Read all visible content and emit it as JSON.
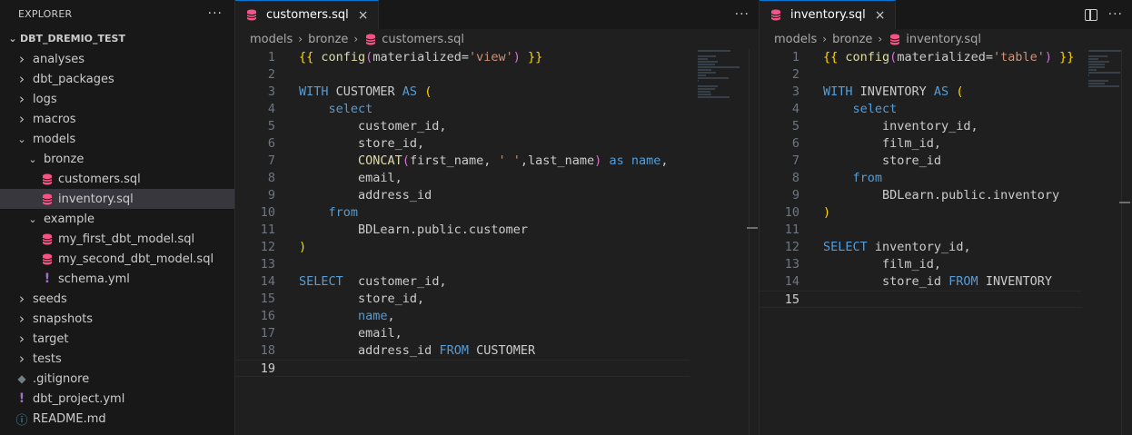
{
  "explorer": {
    "title": "EXPLORER",
    "more_label": "···",
    "root_label": "DBT_DREMIO_TEST",
    "items": [
      {
        "label": "analyses",
        "kind": "folder",
        "depth": 0,
        "expanded": false
      },
      {
        "label": "dbt_packages",
        "kind": "folder",
        "depth": 0,
        "expanded": false
      },
      {
        "label": "logs",
        "kind": "folder",
        "depth": 0,
        "expanded": false
      },
      {
        "label": "macros",
        "kind": "folder",
        "depth": 0,
        "expanded": false
      },
      {
        "label": "models",
        "kind": "folder",
        "depth": 0,
        "expanded": true
      },
      {
        "label": "bronze",
        "kind": "folder",
        "depth": 1,
        "expanded": true
      },
      {
        "label": "customers.sql",
        "kind": "sql",
        "depth": 2
      },
      {
        "label": "inventory.sql",
        "kind": "sql",
        "depth": 2,
        "selected": true
      },
      {
        "label": "example",
        "kind": "folder",
        "depth": 1,
        "expanded": true
      },
      {
        "label": "my_first_dbt_model.sql",
        "kind": "sql",
        "depth": 2
      },
      {
        "label": "my_second_dbt_model.sql",
        "kind": "sql",
        "depth": 2
      },
      {
        "label": "schema.yml",
        "kind": "yml",
        "depth": 2
      },
      {
        "label": "seeds",
        "kind": "folder",
        "depth": 0,
        "expanded": false
      },
      {
        "label": "snapshots",
        "kind": "folder",
        "depth": 0,
        "expanded": false
      },
      {
        "label": "target",
        "kind": "folder",
        "depth": 0,
        "expanded": false
      },
      {
        "label": "tests",
        "kind": "folder",
        "depth": 0,
        "expanded": false
      },
      {
        "label": ".gitignore",
        "kind": "git",
        "depth": 0
      },
      {
        "label": "dbt_project.yml",
        "kind": "yml",
        "depth": 0
      },
      {
        "label": "README.md",
        "kind": "info",
        "depth": 0
      }
    ]
  },
  "left_editor": {
    "tab_label": "customers.sql",
    "tab_close": "×",
    "more_label": "···",
    "breadcrumb": [
      "models",
      "bronze",
      "customers.sql"
    ],
    "current_line": 19,
    "lines": [
      [
        [
          "{{ ",
          "brace"
        ],
        [
          "config",
          "fn"
        ],
        [
          "(",
          "paren2"
        ],
        [
          "materialized=",
          "plain"
        ],
        [
          "'view'",
          "str"
        ],
        [
          ")",
          "paren2"
        ],
        [
          " }}",
          "brace"
        ]
      ],
      [],
      [
        [
          "WITH",
          "kw"
        ],
        [
          " CUSTOMER ",
          "plain"
        ],
        [
          "AS",
          "kw"
        ],
        [
          " (",
          "brace"
        ]
      ],
      [
        [
          "    select",
          "kw"
        ]
      ],
      [
        [
          "        customer_id,",
          "plain"
        ]
      ],
      [
        [
          "        store_id,",
          "plain"
        ]
      ],
      [
        [
          "        ",
          "plain"
        ],
        [
          "CONCAT",
          "fn"
        ],
        [
          "(",
          "paren2"
        ],
        [
          "first_name, ",
          "plain"
        ],
        [
          "' '",
          "str"
        ],
        [
          ",last_name",
          "plain"
        ],
        [
          ")",
          "paren2"
        ],
        [
          " as ",
          "kw"
        ],
        [
          "name",
          "kw"
        ],
        [
          ",",
          "plain"
        ]
      ],
      [
        [
          "        email,",
          "plain"
        ]
      ],
      [
        [
          "        address_id",
          "plain"
        ]
      ],
      [
        [
          "    from",
          "kw"
        ]
      ],
      [
        [
          "        BDLearn.public.customer",
          "plain"
        ]
      ],
      [
        [
          ")",
          "brace"
        ]
      ],
      [],
      [
        [
          "SELECT",
          "kw"
        ],
        [
          "  customer_id,",
          "plain"
        ]
      ],
      [
        [
          "        store_id,",
          "plain"
        ]
      ],
      [
        [
          "        ",
          "plain"
        ],
        [
          "name",
          "kw"
        ],
        [
          ",",
          "plain"
        ]
      ],
      [
        [
          "        email,",
          "plain"
        ]
      ],
      [
        [
          "        address_id ",
          "plain"
        ],
        [
          "FROM",
          "kw"
        ],
        [
          " CUSTOMER",
          "plain"
        ]
      ],
      []
    ]
  },
  "right_editor": {
    "tab_label": "inventory.sql",
    "tab_close": "×",
    "more_label": "···",
    "breadcrumb": [
      "models",
      "bronze",
      "inventory.sql"
    ],
    "current_line": 15,
    "lines": [
      [
        [
          "{{ ",
          "brace"
        ],
        [
          "config",
          "fn"
        ],
        [
          "(",
          "paren2"
        ],
        [
          "materialized=",
          "plain"
        ],
        [
          "'table'",
          "str"
        ],
        [
          ")",
          "paren2"
        ],
        [
          " }}",
          "brace"
        ]
      ],
      [],
      [
        [
          "WITH",
          "kw"
        ],
        [
          " INVENTORY ",
          "plain"
        ],
        [
          "AS",
          "kw"
        ],
        [
          " (",
          "brace"
        ]
      ],
      [
        [
          "    select",
          "kw"
        ]
      ],
      [
        [
          "        inventory_id,",
          "plain"
        ]
      ],
      [
        [
          "        film_id,",
          "plain"
        ]
      ],
      [
        [
          "        store_id",
          "plain"
        ]
      ],
      [
        [
          "    from",
          "kw"
        ]
      ],
      [
        [
          "        BDLearn.public.inventory",
          "plain"
        ]
      ],
      [
        [
          ")",
          "brace"
        ]
      ],
      [],
      [
        [
          "SELECT",
          "kw"
        ],
        [
          " inventory_id,",
          "plain"
        ]
      ],
      [
        [
          "        film_id,",
          "plain"
        ]
      ],
      [
        [
          "        store_id ",
          "plain"
        ],
        [
          "FROM",
          "kw"
        ],
        [
          " INVENTORY",
          "plain"
        ]
      ],
      []
    ]
  },
  "colors": {
    "accent": "#0078d4",
    "sql_icon": "#f55385",
    "keyword": "#569cd6",
    "string": "#ce9178",
    "function": "#dcdcaa",
    "brace": "#ffd700",
    "paren": "#da70d6"
  }
}
